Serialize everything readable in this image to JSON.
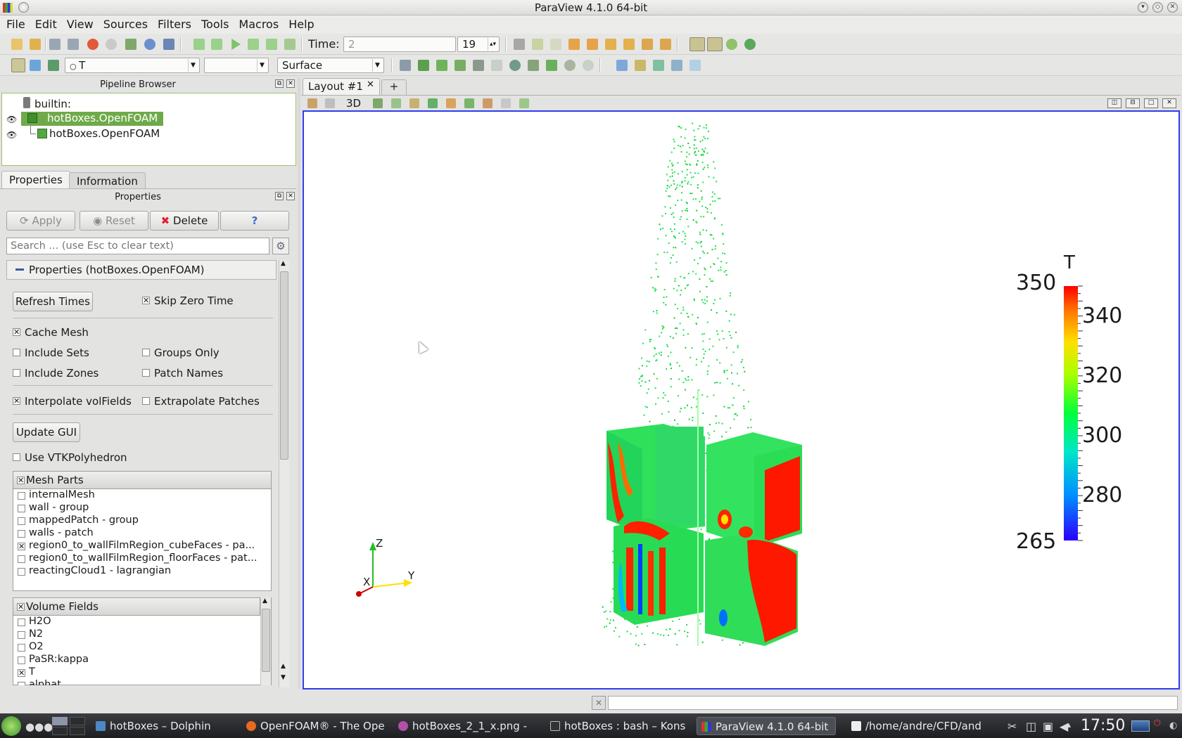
{
  "window": {
    "title": "ParaView 4.1.0 64-bit",
    "buttons": [
      "chevron-down-icon",
      "maximize-icon",
      "close-icon"
    ]
  },
  "menubar": [
    "File",
    "Edit",
    "View",
    "Sources",
    "Filters",
    "Tools",
    "Macros",
    "Help"
  ],
  "time_toolbar": {
    "label": "Time:",
    "time_value": "2",
    "index_value": "19"
  },
  "representation_toolbar": {
    "array": "T",
    "component": "",
    "representation": "Surface"
  },
  "pipeline_browser": {
    "title": "Pipeline Browser",
    "root": "builtin:",
    "items": [
      {
        "label": "hotBoxes.OpenFOAM",
        "selected": true,
        "visible": true
      },
      {
        "label": "hotBoxes.OpenFOAM",
        "selected": false,
        "visible": true
      }
    ]
  },
  "tabs": [
    {
      "label": "Properties",
      "active": true
    },
    {
      "label": "Information",
      "active": false
    }
  ],
  "properties": {
    "title": "Properties",
    "buttons": {
      "apply": "Apply",
      "reset": "Reset",
      "delete": "Delete",
      "help": "?"
    },
    "search_placeholder": "Search ... (use Esc to clear text)",
    "section_title": "Properties (hotBoxes.OpenFOAM)",
    "refresh_times": "Refresh Times",
    "skip_zero_time": {
      "label": "Skip Zero Time",
      "checked": true
    },
    "cache_mesh": {
      "label": "Cache Mesh",
      "checked": true
    },
    "include_sets": {
      "label": "Include Sets",
      "checked": false
    },
    "groups_only": {
      "label": "Groups Only",
      "checked": false
    },
    "include_zones": {
      "label": "Include Zones",
      "checked": false
    },
    "patch_names": {
      "label": "Patch Names",
      "checked": false
    },
    "interpolate_volfields": {
      "label": "Interpolate volFields",
      "checked": true
    },
    "extrapolate_patches": {
      "label": "Extrapolate Patches",
      "checked": false
    },
    "update_gui": "Update GUI",
    "use_vtkpolyhedron": {
      "label": "Use VTKPolyhedron",
      "checked": false
    },
    "mesh_parts": {
      "header": "Mesh Parts",
      "rows": [
        {
          "label": "internalMesh",
          "checked": false
        },
        {
          "label": "wall - group",
          "checked": false
        },
        {
          "label": "mappedPatch - group",
          "checked": false
        },
        {
          "label": "walls - patch",
          "checked": false
        },
        {
          "label": "region0_to_wallFilmRegion_cubeFaces - pa...",
          "checked": true
        },
        {
          "label": "region0_to_wallFilmRegion_floorFaces - pat...",
          "checked": false
        },
        {
          "label": "reactingCloud1 - lagrangian",
          "checked": false
        }
      ]
    },
    "volume_fields": {
      "header": "Volume Fields",
      "rows": [
        {
          "label": "H2O",
          "checked": false
        },
        {
          "label": "N2",
          "checked": false
        },
        {
          "label": "O2",
          "checked": false
        },
        {
          "label": "PaSR:kappa",
          "checked": false
        },
        {
          "label": "T",
          "checked": true
        },
        {
          "label": "alphat",
          "checked": false
        }
      ]
    }
  },
  "layout": {
    "tab_label": "Layout #1",
    "add_tab": "+",
    "view_mode": "3D"
  },
  "colorbar": {
    "title": "T",
    "min_label": "265",
    "max_label": "350",
    "ticks": [
      "340",
      "320",
      "300",
      "280"
    ],
    "min": 265,
    "max": 350,
    "tick_values": [
      340,
      320,
      300,
      280
    ]
  },
  "axes": {
    "x": "X",
    "y": "Y",
    "z": "Z"
  },
  "taskbar": {
    "tasks": [
      {
        "label": "hotBoxes – Dolphin",
        "active": false
      },
      {
        "label": "OpenFOAM® - The Ope",
        "active": false
      },
      {
        "label": "hotBoxes_2_1_x.png -",
        "active": false
      },
      {
        "label": "hotBoxes : bash – Kons",
        "active": false
      },
      {
        "label": "ParaView 4.1.0 64-bit",
        "active": true
      },
      {
        "label": "/home/andre/CFD/andr",
        "active": false
      }
    ],
    "clock": "17:50"
  }
}
